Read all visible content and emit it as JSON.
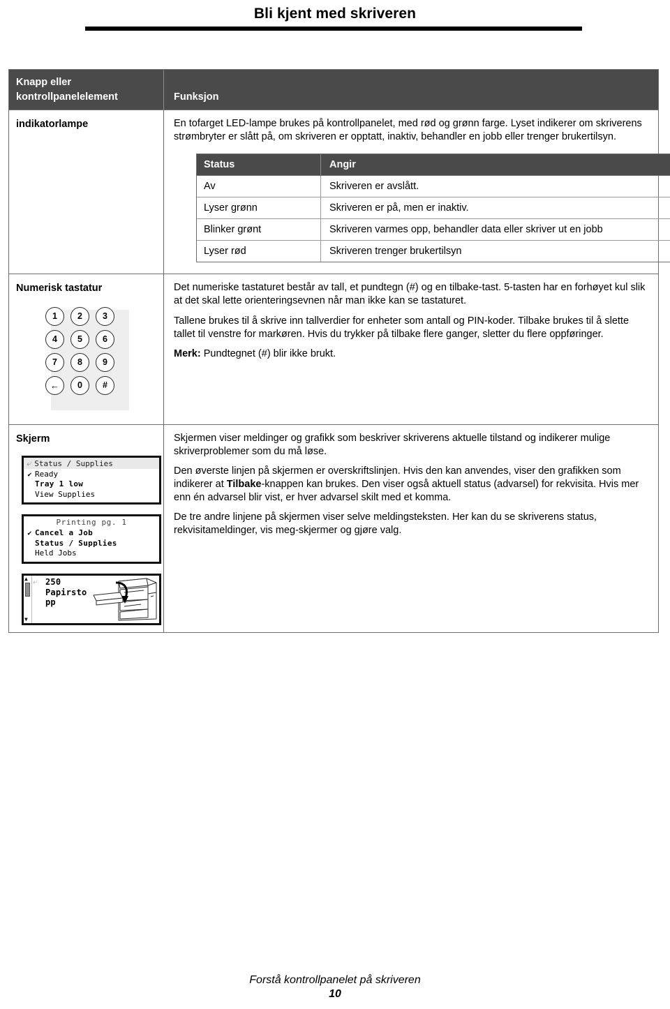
{
  "page": {
    "title": "Bli kjent med skriveren",
    "footer_text": "Forstå kontrollpanelet på skriveren",
    "page_number": "10",
    "accent_dark": "#4a4a4a",
    "border_gray": "#6e6e6e",
    "keypad_panel_gray": "#eeeeee"
  },
  "table": {
    "header": {
      "col1": "Knapp eller kontrollpanelelement",
      "col2": "Funksjon"
    },
    "rows": [
      {
        "label": "indikatorlampe",
        "paragraphs": [
          "En tofarget LED-lampe brukes på kontrollpanelet, med rød og grønn farge. Lyset indikerer om skriverens strømbryter er slått på, om skriveren er opptatt, inaktiv, behandler en jobb eller trenger brukertilsyn."
        ],
        "status_table": {
          "headers": [
            "Status",
            "Angir"
          ],
          "rows": [
            [
              "Av",
              "Skriveren er avslått."
            ],
            [
              "Lyser grønn",
              "Skriveren er på, men er inaktiv."
            ],
            [
              "Blinker grønt",
              "Skriveren varmes opp, behandler data eller skriver ut en jobb"
            ],
            [
              "Lyser rød",
              "Skriveren trenger brukertilsyn"
            ]
          ]
        }
      },
      {
        "label": "Numerisk tastatur",
        "paragraphs": [
          "Det numeriske tastaturet består av tall, et pundtegn (#) og en tilbake-tast. 5-tasten har en forhøyet kul slik at det skal lette orienteringsevnen når man ikke kan se tastaturet.",
          "Tallene brukes til å skrive inn tallverdier for enheter som antall og PIN-koder. Tilbake brukes til å slette tallet til venstre for markøren. Hvis du trykker på tilbake flere ganger, sletter du flere oppføringer."
        ],
        "note_label": "Merk:",
        "note_text": " Pundtegnet (#) blir ikke brukt.",
        "keypad": {
          "keys": [
            "1",
            "2",
            "3",
            "4",
            "5",
            "6",
            "7",
            "8",
            "9",
            "←",
            "0",
            "#"
          ]
        }
      },
      {
        "label": "Skjerm",
        "paragraphs": [
          "Skjermen viser meldinger og grafikk som beskriver skriverens aktuelle tilstand og indikerer mulige skriverproblemer som du må løse.",
          "De tre andre linjene på skjermen viser selve meldingsteksten. Her kan du se skriverens status, rekvisitameldinger, vis meg-skjermer og gjøre valg."
        ],
        "paragraph_rich": {
          "part1": "Den øverste linjen på skjermen er overskriftslinjen. Hvis den kan anvendes, viser den grafikken som indikerer at ",
          "bold": "Tilbake",
          "part2": "-knappen kan brukes. Den viser også aktuell status (advarsel) for rekvisita. Hvis mer enn én advarsel blir vist, er hver advarsel skilt med et komma."
        }
      }
    ]
  },
  "lcd_panels": [
    {
      "header": "Status / Supplies",
      "header_icon": "back-arrow-icon",
      "lines": [
        {
          "check": "✔",
          "text": "Ready",
          "style": "plain"
        },
        {
          "check": "",
          "text": "Tray 1 low",
          "style": "bold"
        },
        {
          "check": "",
          "text": "View Supplies",
          "style": "plain"
        }
      ]
    },
    {
      "header": "Printing pg. 1",
      "header_icon": "",
      "lines": [
        {
          "check": "✔",
          "text": "Cancel a Job",
          "style": "bold"
        },
        {
          "check": "",
          "text": "Status / Supplies",
          "style": "bold"
        },
        {
          "check": "",
          "text": "Held Jobs",
          "style": "plain"
        }
      ]
    },
    {
      "header": "",
      "header_icon": "back-arrow-icon",
      "message_lines": [
        "250",
        "Papirsto",
        "pp"
      ],
      "illustration": "printer-open-door-arrow"
    }
  ]
}
